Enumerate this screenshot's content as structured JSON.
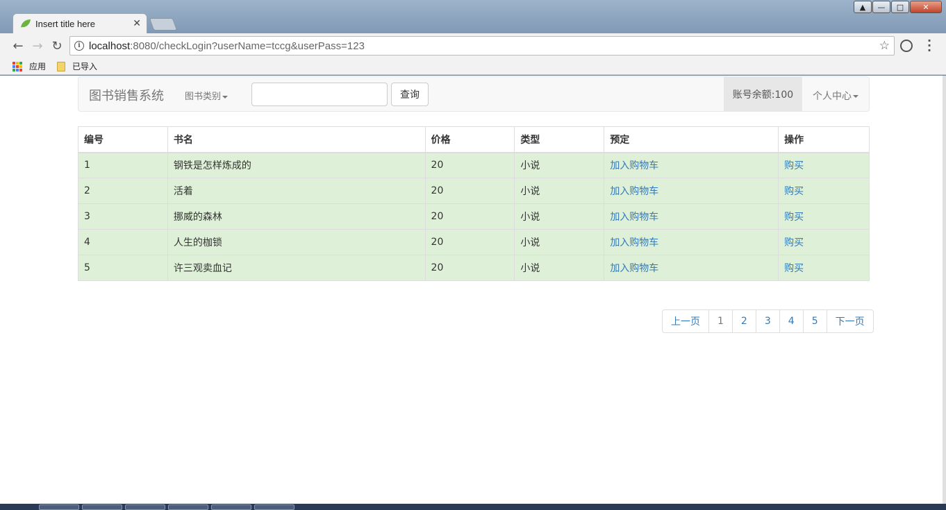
{
  "browser": {
    "tab_title": "Insert title here",
    "url_host": "localhost",
    "url_rest": ":8080/checkLogin?userName=tccg&userPass=123",
    "bookmarks": [
      "应用",
      "已导入"
    ]
  },
  "navbar": {
    "brand": "图书销售系统",
    "category_dropdown": "图书类别",
    "search_placeholder": "",
    "search_button": "查询",
    "balance": "账号余额:100",
    "user_center": "个人中心"
  },
  "table": {
    "headers": [
      "编号",
      "书名",
      "价格",
      "类型",
      "预定",
      "操作"
    ],
    "rows": [
      {
        "id": "1",
        "name": "钢铁是怎样炼成的",
        "price": "20",
        "type": "小说",
        "reserve": "加入购物车",
        "action": "购买"
      },
      {
        "id": "2",
        "name": "活着",
        "price": "20",
        "type": "小说",
        "reserve": "加入购物车",
        "action": "购买"
      },
      {
        "id": "3",
        "name": "挪威的森林",
        "price": "20",
        "type": "小说",
        "reserve": "加入购物车",
        "action": "购买"
      },
      {
        "id": "4",
        "name": "人生的枷锁",
        "price": "20",
        "type": "小说",
        "reserve": "加入购物车",
        "action": "购买"
      },
      {
        "id": "5",
        "name": "许三观卖血记",
        "price": "20",
        "type": "小说",
        "reserve": "加入购物车",
        "action": "购买"
      }
    ]
  },
  "pagination": {
    "prev": "上一页",
    "pages": [
      "1",
      "2",
      "3",
      "4",
      "5"
    ],
    "next": "下一页"
  },
  "colors": {
    "link": "#337ab7",
    "row_success": "#dff0d8",
    "navbar_bg": "#f8f8f8"
  }
}
